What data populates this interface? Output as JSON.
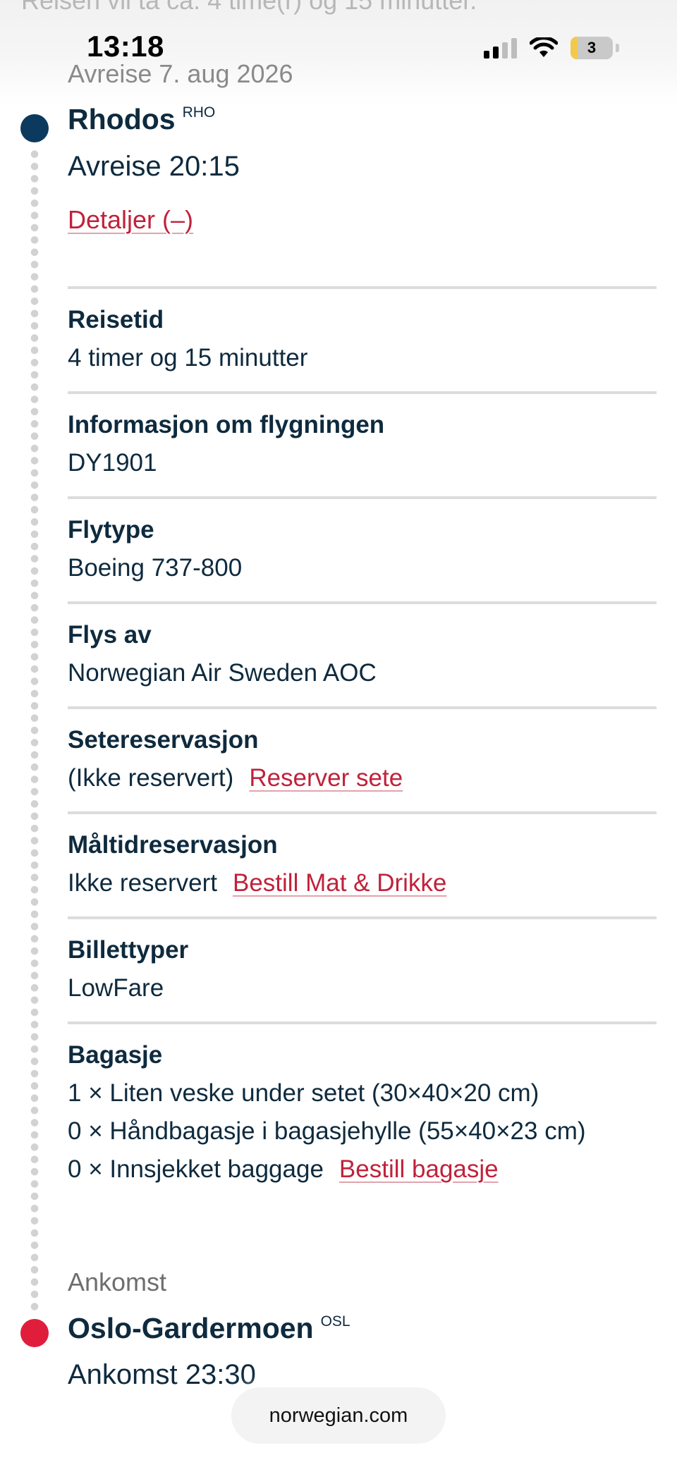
{
  "status_bar": {
    "time": "13:18",
    "battery": "3"
  },
  "overflow_text": "Reisen vil ta ca. 4 time(r) og 15 minutter.",
  "departure": {
    "date_label": "Avreise 7. aug 2026",
    "airport": "Rhodos",
    "code": "RHO",
    "time_label": "Avreise 20:15",
    "details_link": "Detaljer (–)"
  },
  "sections": {
    "travel_time": {
      "title": "Reisetid",
      "value": "4 timer og 15 minutter"
    },
    "flight_info": {
      "title": "Informasjon om flygningen",
      "value": "DY1901"
    },
    "aircraft": {
      "title": "Flytype",
      "value": "Boeing 737-800"
    },
    "operated_by": {
      "title": "Flys av",
      "value": "Norwegian Air Sweden AOC"
    },
    "seat": {
      "title": "Setereservasjon",
      "value": "(Ikke reservert)",
      "link": "Reserver sete"
    },
    "meal": {
      "title": "Måltidreservasjon",
      "value": "Ikke reservert",
      "link": "Bestill Mat & Drikke"
    },
    "ticket": {
      "title": "Billettyper",
      "value": "LowFare"
    },
    "baggage": {
      "title": "Bagasje",
      "lines": [
        "1 × Liten veske under setet (30×40×20 cm)",
        "0 × Håndbagasje i bagasjehylle (55×40×23 cm)",
        "0 × Innsjekket baggage"
      ],
      "link": "Bestill bagasje"
    }
  },
  "arrival": {
    "label": "Ankomst",
    "airport": "Oslo-Gardermoen",
    "code": "OSL",
    "time_label": "Ankomst 23:30"
  },
  "browser": {
    "url": "norwegian.com"
  },
  "colors": {
    "navy": "#0e2a3e",
    "link_red": "#c0223b",
    "timeline_start": "#0b3a5e",
    "timeline_end": "#e01e3c"
  }
}
